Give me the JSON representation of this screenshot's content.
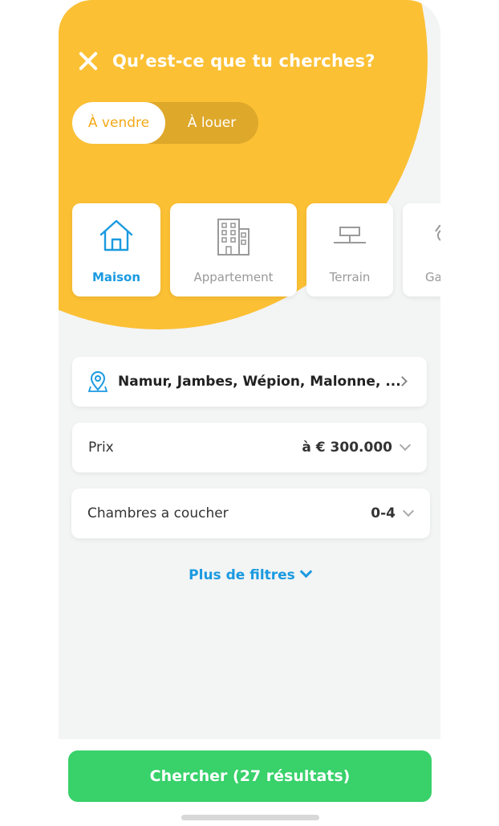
{
  "header": {
    "title": "Qu’est-ce que tu cherches?"
  },
  "mode_toggle": {
    "options": [
      "À vendre",
      "À louer"
    ],
    "selected": "À vendre"
  },
  "property_types": [
    {
      "label": "Maison",
      "icon": "house-icon",
      "selected": true
    },
    {
      "label": "Appartement",
      "icon": "building-icon",
      "selected": false
    },
    {
      "label": "Terrain",
      "icon": "land-sign-icon",
      "selected": false
    },
    {
      "label": "Ga",
      "icon": "garage-icon",
      "selected": false
    }
  ],
  "filters": {
    "location": {
      "icon": "location-pin-icon",
      "value": "Namur, Jambes, Wépion, Malonne, ..."
    },
    "price": {
      "label": "Prix",
      "value": "à € 300.000"
    },
    "bedrooms": {
      "label": "Chambres a coucher",
      "value": "0-4"
    }
  },
  "more_filters": {
    "label": "Plus de filtres"
  },
  "search_button": {
    "label": "Chercher (27 résultats)"
  },
  "colors": {
    "accent_yellow": "#fbc034",
    "accent_blue": "#1a9ae0",
    "cta_green": "#38d16a"
  }
}
